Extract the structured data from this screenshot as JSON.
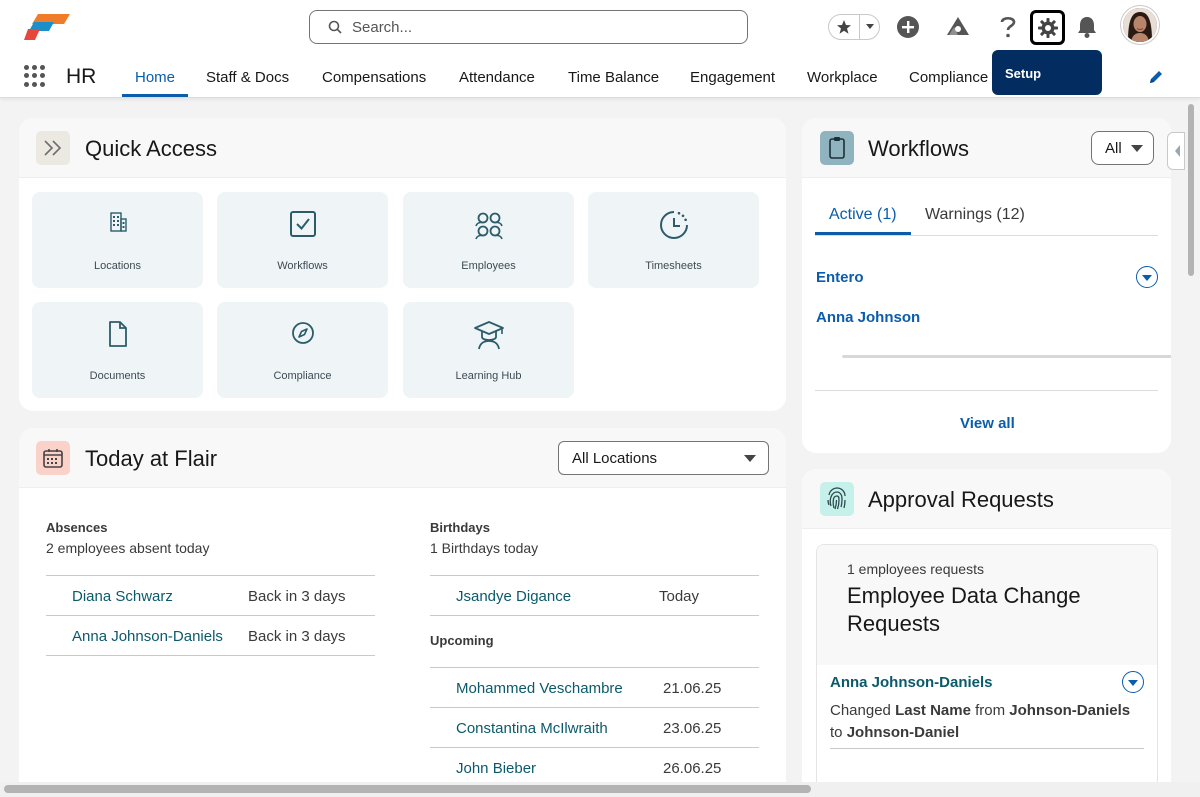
{
  "header": {
    "search_placeholder": "Search...",
    "tooltip": "Setup"
  },
  "nav": {
    "app_name": "HR",
    "tabs": [
      "Home",
      "Staff & Docs",
      "Compensations",
      "Attendance",
      "Time Balance",
      "Engagement",
      "Workplace",
      "Compliance"
    ],
    "active_tab": "Home"
  },
  "quick_access": {
    "title": "Quick Access",
    "tiles": [
      {
        "label": "Locations",
        "icon": "building-icon"
      },
      {
        "label": "Workflows",
        "icon": "checkbox-icon"
      },
      {
        "label": "Employees",
        "icon": "people-icon"
      },
      {
        "label": "Timesheets",
        "icon": "clock-icon"
      },
      {
        "label": "Documents",
        "icon": "document-icon"
      },
      {
        "label": "Compliance",
        "icon": "compass-icon"
      },
      {
        "label": "Learning Hub",
        "icon": "graduation-icon"
      }
    ]
  },
  "today": {
    "title": "Today at Flair",
    "location_filter": "All Locations",
    "absences": {
      "label": "Absences",
      "summary": "2 employees absent today",
      "rows": [
        {
          "name": "Diana Schwarz",
          "status": "Back in 3 days"
        },
        {
          "name": "Anna Johnson-Daniels",
          "status": "Back in 3 days"
        }
      ]
    },
    "birthdays": {
      "label": "Birthdays",
      "summary": "1 Birthdays today",
      "today_rows": [
        {
          "name": "Jsandye Digance",
          "date": "Today"
        }
      ],
      "upcoming_label": "Upcoming",
      "upcoming_rows": [
        {
          "name": "Mohammed Veschambre",
          "date": "21.06.25"
        },
        {
          "name": "Constantina McIlwraith",
          "date": "23.06.25"
        },
        {
          "name": "John Bieber",
          "date": "26.06.25"
        }
      ]
    }
  },
  "workflows": {
    "title": "Workflows",
    "filter": "All",
    "tabs": [
      "Active (1)",
      "Warnings (12)"
    ],
    "group": "Entero",
    "person": "Anna Johnson",
    "view_all": "View all"
  },
  "approvals": {
    "title": "Approval Requests",
    "count_text": "1 employees requests",
    "request_title": "Employee Data Change Requests",
    "item": {
      "name": "Anna Johnson-Daniels",
      "text_changed": "Changed",
      "field": "Last Name",
      "text_from": "from",
      "old_value": "Johnson-Daniels",
      "text_to": "to",
      "new_value": "Johnson-Daniel"
    }
  },
  "colors": {
    "brand_blue": "#0b5cab",
    "link_teal": "#0b5a6b",
    "tooltip_bg": "#032d60"
  }
}
